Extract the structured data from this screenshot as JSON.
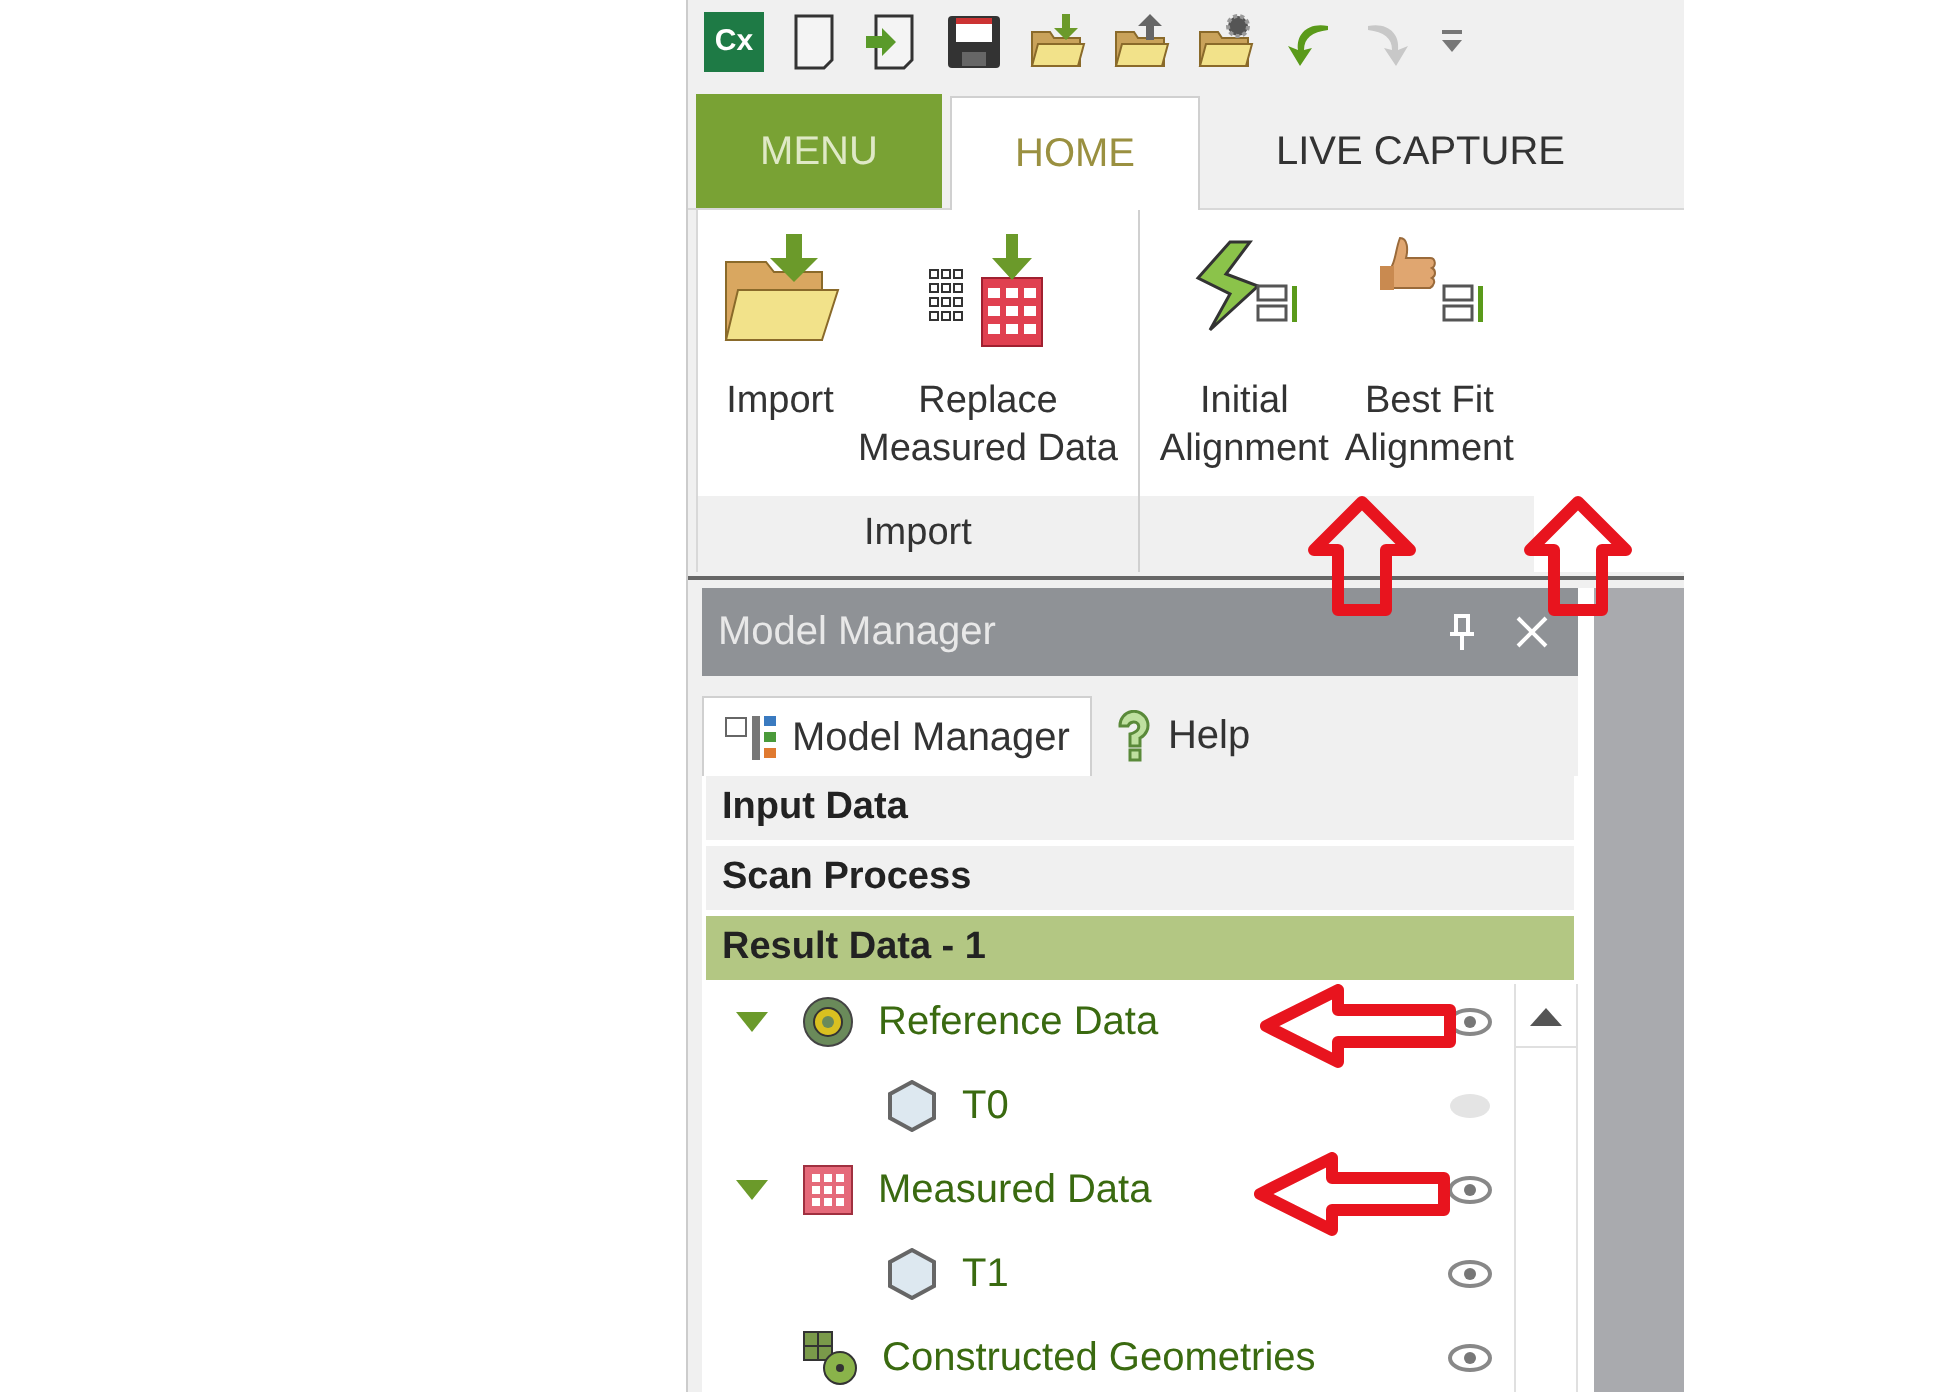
{
  "app_logo": "Cx",
  "tabs": [
    {
      "label": "MENU",
      "kind": "menu",
      "selected": false
    },
    {
      "label": "HOME",
      "kind": "tab",
      "selected": true
    },
    {
      "label": "LIVE CAPTURE",
      "kind": "tab",
      "selected": false
    }
  ],
  "ribbon_groups": [
    {
      "label": "Import",
      "buttons": [
        {
          "kind": "import",
          "lines": [
            "Import"
          ]
        },
        {
          "kind": "replace",
          "lines": [
            "Replace",
            "Measured Data"
          ]
        }
      ]
    },
    {
      "buttons": [
        {
          "kind": "initial",
          "lines": [
            "Initial",
            "Alignment"
          ]
        },
        {
          "kind": "bestfit",
          "lines": [
            "Best Fit",
            "Alignment"
          ]
        }
      ]
    }
  ],
  "panel": {
    "title": "Model Manager",
    "tabs": [
      {
        "label": "Model Manager",
        "kind": "model",
        "selected": true
      },
      {
        "label": "Help",
        "kind": "help",
        "selected": false
      }
    ],
    "sections": [
      {
        "label": "Input Data",
        "selected": false
      },
      {
        "label": "Scan Process",
        "selected": false
      },
      {
        "label": "Result Data - 1",
        "selected": true
      }
    ],
    "tree": [
      {
        "label": "Reference Data",
        "kind": "reference",
        "expanded": true,
        "visible": true,
        "children": [
          {
            "label": "T0",
            "kind": "mesh",
            "visible": false
          }
        ]
      },
      {
        "label": "Measured Data",
        "kind": "measured",
        "expanded": true,
        "visible": true,
        "children": [
          {
            "label": "T1",
            "kind": "mesh",
            "visible": true
          }
        ]
      },
      {
        "label": "Constructed Geometries",
        "kind": "constructed",
        "visible": true
      }
    ]
  }
}
